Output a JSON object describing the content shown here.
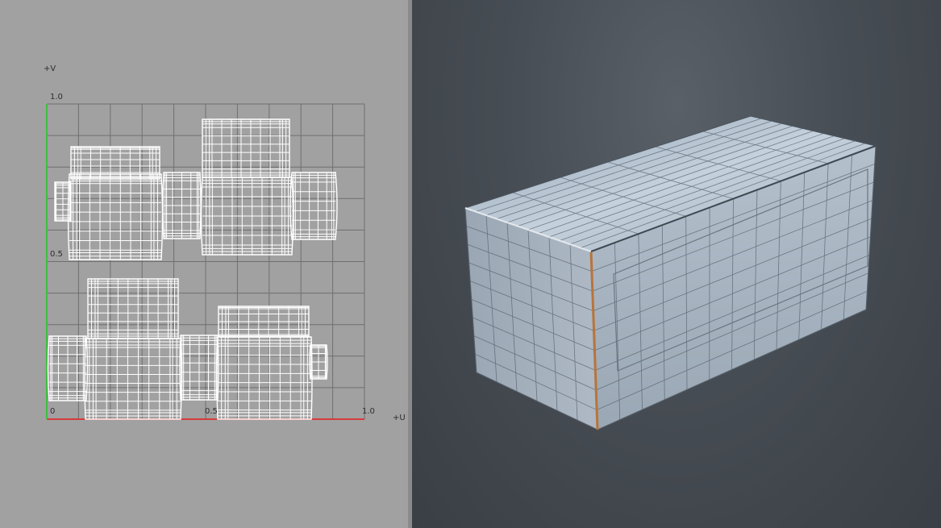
{
  "uv_editor": {
    "axis_v_label": "+V",
    "axis_u_label": "+U",
    "tick_v_top": "1.0",
    "tick_v_mid": "0.5",
    "tick_origin": "0",
    "tick_u_mid": "0.5",
    "tick_u_right": "1.0",
    "grid_divisions": 10,
    "colors": {
      "background": "#a1a1a1",
      "grid": "#6f6f6f",
      "wire": "#ffffff",
      "u_axis": "#d63b3b",
      "v_axis": "#3fbf3f"
    }
  },
  "viewport": {
    "object_icon": "box-mesh",
    "colors": {
      "mesh_face": "#a7b3c0",
      "mesh_wire": "#55606c",
      "seam": "#b8743a"
    }
  }
}
